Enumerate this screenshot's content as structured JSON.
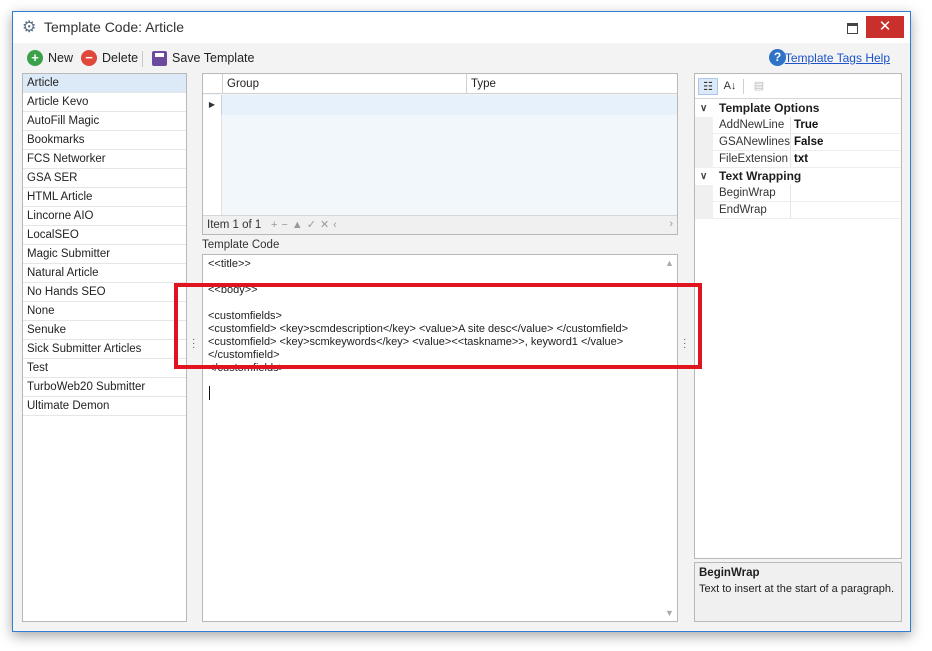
{
  "window": {
    "title": "Template Code: Article",
    "close_glyph": "✕"
  },
  "toolbar": {
    "new_label": "New",
    "delete_label": "Delete",
    "save_label": "Save Template",
    "help_link": "Template Tags Help"
  },
  "templates": {
    "items": [
      "Article",
      "Article Kevo",
      "AutoFill Magic",
      "Bookmarks",
      "FCS Networker",
      "GSA SER",
      "HTML Article",
      "Lincorne AIO",
      "LocalSEO",
      "Magic Submitter",
      "Natural Article",
      "No Hands SEO",
      "None",
      "Senuke",
      "Sick Submitter Articles",
      "Test",
      "TurboWeb20 Submitter",
      "Ultimate Demon"
    ],
    "selected_index": 0
  },
  "grid": {
    "columns": [
      "Group",
      "Type"
    ],
    "navigator": "Item 1 of 1"
  },
  "code": {
    "label": "Template Code",
    "text": "<<title>>\n\n<<body>>\n\n<customfields>\n<customfield> <key>scmdescription</key> <value>A site desc</value> </customfield>\n<customfield> <key>scmkeywords</key> <value><<taskname>>, keyword1 </value>\n</customfield>\n</customfields>"
  },
  "properties": {
    "categories": [
      {
        "name": "Template Options",
        "rows": [
          {
            "name": "AddNewLine",
            "value": "True"
          },
          {
            "name": "GSANewlines",
            "value": "False"
          },
          {
            "name": "FileExtension",
            "value": "txt"
          }
        ]
      },
      {
        "name": "Text Wrapping",
        "rows": [
          {
            "name": "BeginWrap",
            "value": ""
          },
          {
            "name": "EndWrap",
            "value": ""
          }
        ]
      }
    ]
  },
  "description": {
    "title": "BeginWrap",
    "text": "Text to insert at the start of a paragraph."
  },
  "colors": {
    "accent": "#2d7fd3",
    "highlight_box": "#e0141e",
    "close_button": "#c9302c",
    "selection": "#dce9f7"
  },
  "icons": {
    "title": "gears-icon",
    "new": "plus-circle-icon",
    "delete": "minus-circle-icon",
    "save": "floppy-disk-icon",
    "help": "question-circle-icon",
    "categorized": "categorized-view-icon",
    "alphabetical": "sort-az-icon",
    "property_pages": "property-pages-icon"
  }
}
